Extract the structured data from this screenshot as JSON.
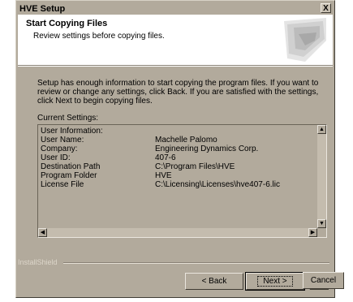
{
  "window": {
    "title": "HVE Setup",
    "close_label": "X"
  },
  "header": {
    "title": "Start Copying Files",
    "subtitle": "Review settings before copying files."
  },
  "body": {
    "description": "Setup has enough information to start copying the program files.  If you want to review or change any settings, click Back.  If you are satisfied with the settings, click Next to begin copying files.",
    "settings_label": "Current Settings:"
  },
  "settings": {
    "section_title": "User Information:",
    "rows": [
      {
        "key": "User Name:",
        "value": "Machelle Palomo"
      },
      {
        "key": "Company:",
        "value": "Engineering Dynamics Corp."
      },
      {
        "key": "User ID:",
        "value": "407-6"
      },
      {
        "key": "Destination Path",
        "value": "C:\\Program Files\\HVE"
      },
      {
        "key": "Program Folder",
        "value": "HVE"
      },
      {
        "key": "License File",
        "value": "C:\\Licensing\\Licenses\\hve407-6.lic"
      }
    ]
  },
  "footer": {
    "brand": "InstallShield",
    "back_label": "< Back",
    "next_label": "Next >",
    "cancel_label": "Cancel"
  }
}
